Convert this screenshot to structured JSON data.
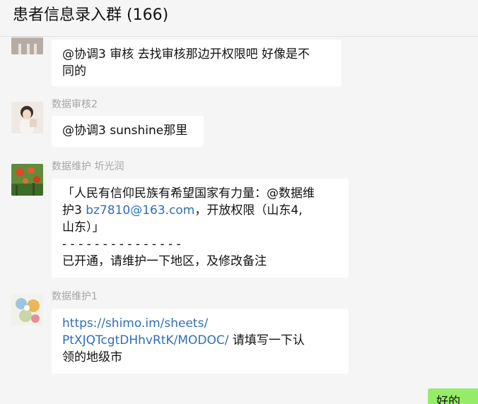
{
  "header": {
    "title": "患者信息录入群 (166)"
  },
  "messages": [
    {
      "sender": "",
      "lines": [
        "@协调3 审核 去找审核那边开权限吧 好像是不",
        "同的"
      ]
    },
    {
      "sender": "数据审核2",
      "lines": [
        "@协调3 sunshine那里"
      ]
    },
    {
      "sender": "数据维护 圻光润",
      "line1": "「人民有信仰民族有希望国家有力量：@数据维",
      "line2_prefix": "护3 ",
      "email": "bz7810@163.com",
      "line2_suffix": "，开放权限（山东4,",
      "line3": "山东）」",
      "line4": "- - - - - - - - - - - - - - -",
      "line5": "已开通，请维护一下地区，及修改备注"
    },
    {
      "sender": "数据维护1",
      "link_line1": "https://shimo.im/sheets/",
      "link_line2": "PtXJQTcgtDHhvRtK/MODOC/",
      "text_line2_suffix": " 请填写一下认",
      "text_line3": "领的地级市"
    }
  ],
  "self_message": {
    "text": "好的"
  }
}
